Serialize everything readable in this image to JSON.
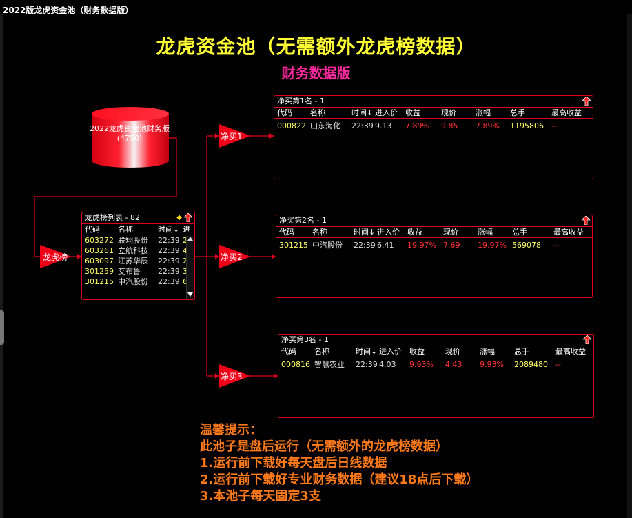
{
  "window": {
    "title": "2022版龙虎资金池（财务数据版）"
  },
  "header": {
    "main_title": "龙虎资金池（无需额外龙虎榜数据）",
    "sub_title": "财务数据版"
  },
  "source": {
    "label": "2022龙虎资金池财务版",
    "count": "(4750)"
  },
  "nodes": {
    "lhb": "龙虎榜",
    "buy1": "净买1",
    "buy2": "净买2",
    "buy3": "净买3"
  },
  "colors": {
    "border": "#e0001b",
    "title": "#ffff33",
    "subtitle": "#ff2aa0",
    "tips": "#ff7a1a"
  },
  "list_panel": {
    "title": "龙虎榜列表 - 82",
    "columns": [
      "代码",
      "名称",
      "时间↓",
      "进"
    ],
    "rows": [
      [
        "603272",
        "联翔股份",
        "22:39",
        "2"
      ],
      [
        "603261",
        "立航科技",
        "22:39",
        "4"
      ],
      [
        "603097",
        "江苏华辰",
        "22:39",
        "2"
      ],
      [
        "301259",
        "艾布鲁",
        "22:39",
        "3"
      ],
      [
        "301215",
        "中汽股份",
        "22:39",
        "6"
      ]
    ]
  },
  "result_columns": [
    "代码",
    "名称",
    "时间↓",
    "进入价",
    "收益",
    "现价",
    "涨幅",
    "总手",
    "最高收益"
  ],
  "panels": [
    {
      "title": "净买第1名 - 1",
      "rows": [
        [
          "000822",
          "山东海化",
          "22:39",
          "9.13",
          "7.89%",
          "9.85",
          "7.89%",
          "1195806",
          "--"
        ]
      ]
    },
    {
      "title": "净买第2名 - 1",
      "rows": [
        [
          "301215",
          "中汽股份",
          "22:39",
          "6.41",
          "19.97%",
          "7.69",
          "19.97%",
          "569078",
          "--"
        ]
      ]
    },
    {
      "title": "净买第3名 - 1",
      "rows": [
        [
          "000816",
          "智慧农业",
          "22:39",
          "4.03",
          "9.93%",
          "4.43",
          "9.93%",
          "2089480",
          "--"
        ]
      ]
    }
  ],
  "tips": {
    "heading": "温馨提示：",
    "lines": [
      "此池子是盘后运行（无需额外的龙虎榜数据）",
      "1.运行前下载好每天盘后日线数据",
      "2.运行前下载好专业财务数据（建议18点后下载）",
      "3.本池子每天固定3支"
    ]
  }
}
